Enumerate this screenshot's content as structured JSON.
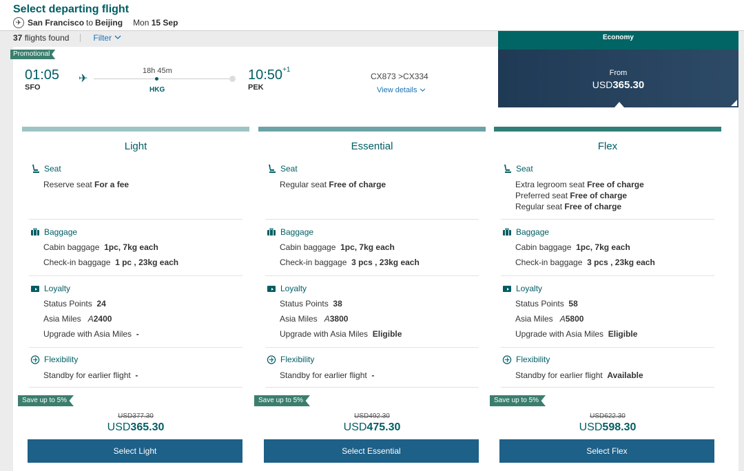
{
  "header": {
    "title": "Select departing flight",
    "origin": "San Francisco",
    "to_word": "to",
    "destination": "Beijing",
    "date_day": "Mon",
    "date": "15 Sep",
    "flights_count": "37",
    "flights_found_label": "flights found",
    "filter_label": "Filter"
  },
  "flight": {
    "promo_label": "Promotional",
    "depart_time": "01:05",
    "depart_code": "SFO",
    "duration": "18h 45m",
    "stop_code": "HKG",
    "arrive_time": "10:50",
    "arrive_day_offset": "+1",
    "arrive_code": "PEK",
    "flight_numbers": "CX873 >CX334",
    "view_details": "View details"
  },
  "cabin": {
    "name": "Economy",
    "from_label": "From",
    "currency": "USD",
    "price": "365.30"
  },
  "labels": {
    "seat": "Seat",
    "baggage": "Baggage",
    "cabin_baggage": "Cabin baggage",
    "checkin_baggage": "Check-in baggage",
    "loyalty": "Loyalty",
    "status_points": "Status Points",
    "asia_miles": "Asia Miles",
    "upgrade": "Upgrade with Asia Miles",
    "flexibility": "Flexibility",
    "standby": "Standby for earlier flight",
    "save_tag": "Save up to 5%",
    "miles_symbol": "A"
  },
  "fares": [
    {
      "name": "Light",
      "bar_color": "#9cc4c4",
      "seat_lines": [
        {
          "text": "Reserve seat",
          "bold": "For a fee"
        }
      ],
      "cabin_baggage": "1pc, 7kg each",
      "checkin_baggage": "1 pc , 23kg each",
      "status_points": "24",
      "asia_miles": "2400",
      "upgrade": "-",
      "standby": "-",
      "old_price": "USD377.30",
      "currency": "USD",
      "price": "365.30",
      "button": "Select Light"
    },
    {
      "name": "Essential",
      "bar_color": "#6ba3a6",
      "seat_lines": [
        {
          "text": "Regular seat",
          "bold": "Free of charge"
        }
      ],
      "cabin_baggage": "1pc, 7kg each",
      "checkin_baggage": "3 pcs , 23kg each",
      "status_points": "38",
      "asia_miles": "3800",
      "upgrade": "Eligible",
      "standby": "-",
      "old_price": "USD492.30",
      "currency": "USD",
      "price": "475.30",
      "button": "Select Essential"
    },
    {
      "name": "Flex",
      "bar_color": "#2f7f79",
      "seat_lines": [
        {
          "text": "Extra legroom seat",
          "bold": "Free of charge"
        },
        {
          "text": "Preferred seat",
          "bold": "Free of charge"
        },
        {
          "text": "Regular seat",
          "bold": "Free of charge"
        }
      ],
      "cabin_baggage": "1pc, 7kg each",
      "checkin_baggage": "3 pcs , 23kg each",
      "status_points": "58",
      "asia_miles": "5800",
      "upgrade": "Eligible",
      "standby": "Available",
      "old_price": "USD622.30",
      "currency": "USD",
      "price": "598.30",
      "button": "Select Flex"
    }
  ]
}
